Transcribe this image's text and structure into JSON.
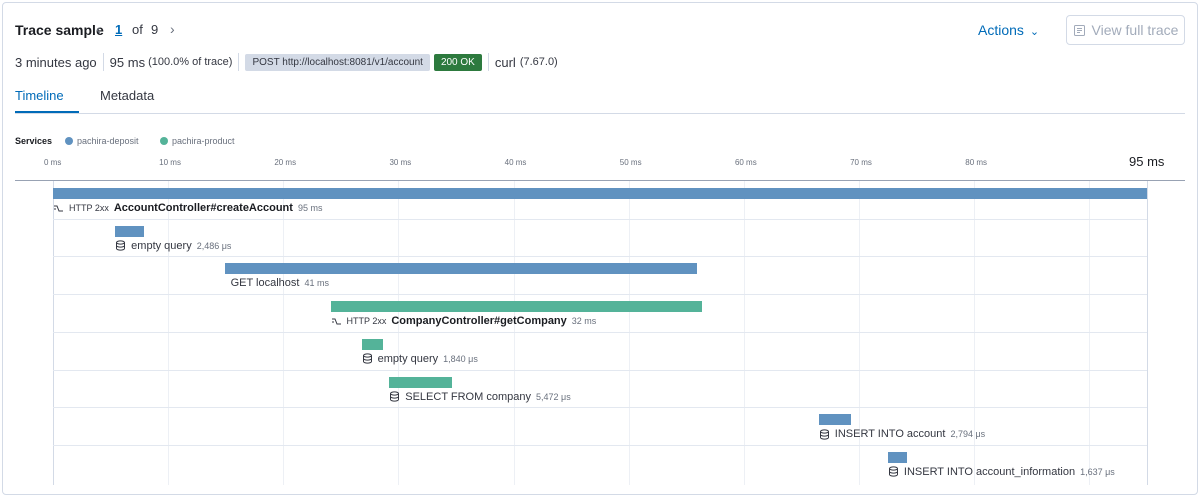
{
  "header": {
    "title": "Trace sample",
    "pager": {
      "current": "1",
      "of_label": "of",
      "total": "9"
    },
    "actions_label": "Actions",
    "view_full_trace_label": "View full trace"
  },
  "summary": {
    "time_ago": "3 minutes ago",
    "duration": "95 ms",
    "duration_pct": "(100.0% of trace)",
    "request": "POST http://localhost:8081/v1/account",
    "status": "200 OK",
    "user_agent": "curl",
    "user_agent_version": "(7.67.0)"
  },
  "tabs": [
    {
      "label": "Timeline",
      "active": true
    },
    {
      "label": "Metadata",
      "active": false
    }
  ],
  "legend": {
    "label": "Services",
    "services": [
      {
        "name": "pachira-deposit",
        "color": "#6092c0"
      },
      {
        "name": "pachira-product",
        "color": "#54b399"
      }
    ]
  },
  "axis": {
    "ticks": [
      "0 ms",
      "10 ms",
      "20 ms",
      "30 ms",
      "40 ms",
      "50 ms",
      "60 ms",
      "70 ms",
      "80 ms"
    ],
    "total": "95 ms",
    "max_ms": 95
  },
  "spans": [
    {
      "kind": "transaction",
      "http": "HTTP 2xx",
      "name": "AccountController#createAccount",
      "duration": "95 ms",
      "start_ms": 0,
      "duration_ms": 95,
      "service": 0,
      "icon": "transaction-icon"
    },
    {
      "kind": "db",
      "name": "empty query",
      "duration": "2,486 μs",
      "start_ms": 5.4,
      "duration_ms": 2.486,
      "service": 0,
      "icon": "database-icon"
    },
    {
      "kind": "external",
      "name": "GET localhost",
      "duration": "41 ms",
      "start_ms": 14.9,
      "duration_ms": 41,
      "service": 0,
      "icon": ""
    },
    {
      "kind": "transaction",
      "http": "HTTP 2xx",
      "name": "CompanyController#getCompany",
      "duration": "32 ms",
      "start_ms": 24.1,
      "duration_ms": 32.3,
      "service": 1,
      "icon": "transaction-icon"
    },
    {
      "kind": "db",
      "name": "empty query",
      "duration": "1,840 μs",
      "start_ms": 26.8,
      "duration_ms": 1.84,
      "service": 1,
      "icon": "database-icon"
    },
    {
      "kind": "db",
      "name": "SELECT FROM company",
      "duration": "5,472 μs",
      "start_ms": 29.2,
      "duration_ms": 5.472,
      "service": 1,
      "icon": "database-icon"
    },
    {
      "kind": "db",
      "name": "INSERT INTO account",
      "duration": "2,794 μs",
      "start_ms": 66.5,
      "duration_ms": 2.794,
      "service": 0,
      "icon": "database-icon"
    },
    {
      "kind": "db",
      "name": "INSERT INTO account_information",
      "duration": "1,637 μs",
      "start_ms": 72.5,
      "duration_ms": 1.637,
      "service": 0,
      "icon": "database-icon"
    }
  ]
}
